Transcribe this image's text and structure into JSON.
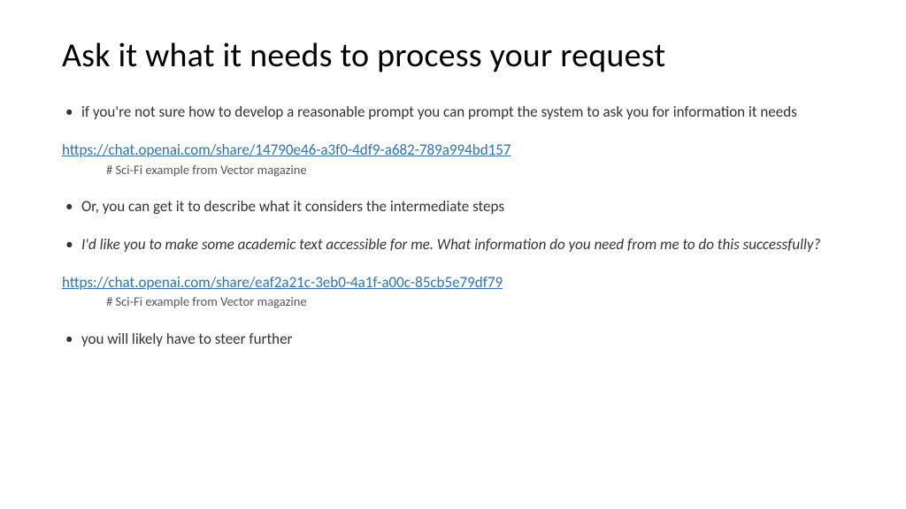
{
  "title": "Ask it what it needs to process your request",
  "items": {
    "b1": "if you're not sure how to develop a reasonable prompt you can prompt the system to ask you for information it needs",
    "link1": "https://chat.openai.com/share/14790e46-a3f0-4df9-a682-789a994bd157",
    "hash1": "# Sci-Fi example from Vector magazine",
    "b2": "Or, you can get it to describe what it considers the intermediate steps",
    "b3": "I'd like you to make some academic text accessible for me. What information do you need from me to do this successfully?",
    "link2": "https://chat.openai.com/share/eaf2a21c-3eb0-4a1f-a00c-85cb5e79df79",
    "hash2": "# Sci-Fi example from Vector magazine",
    "b4": "you will likely have to steer further"
  }
}
